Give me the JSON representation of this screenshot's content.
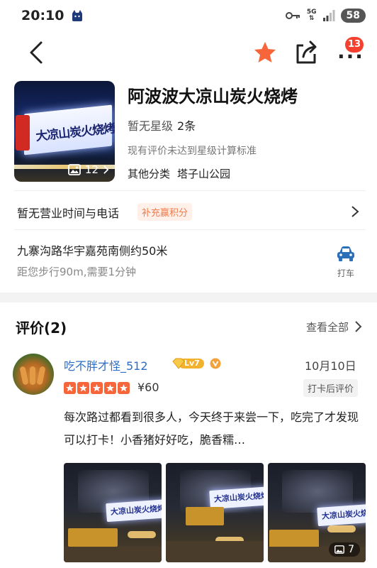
{
  "status_bar": {
    "time": "20:10",
    "network": "5G",
    "battery": "58"
  },
  "nav": {
    "notification_count": "13"
  },
  "shop": {
    "name": "阿波波大凉山炭火烧烤",
    "sign_text": "大凉山炭火烧烤",
    "photo_count": "12",
    "rating_status": "暂无星级",
    "review_count": "2条",
    "rating_note": "现有评价未达到星级计算标准",
    "category": "其他分类",
    "area": "塔子山公园"
  },
  "hours": {
    "text": "暂无营业时间与电话",
    "tag": "补充赢积分"
  },
  "address": {
    "line": "九寨沟路华宇嘉苑南侧约50米",
    "walk": "距您步行90m,需要1分钟",
    "taxi_label": "打车"
  },
  "reviews": {
    "title": "评价(2)",
    "see_all": "查看全部",
    "items": [
      {
        "user": "吃不胖才怪_512",
        "level": "Lv7",
        "date": "10月10日",
        "stars": 5,
        "price": "¥60",
        "tag": "打卡后评价",
        "text": "每次路过都看到很多人，今天终于来尝一下，吃完了才发现可以打卡！小香猪好好吃，脆香糯…",
        "photo_sign": "大凉山炭火烧烤",
        "more_photos": "7"
      }
    ]
  },
  "colors": {
    "accent_orange": "#f7663a",
    "link_blue": "#2d6dc4",
    "badge_red": "#f5402f",
    "taxi_blue": "#2a6fb8"
  }
}
